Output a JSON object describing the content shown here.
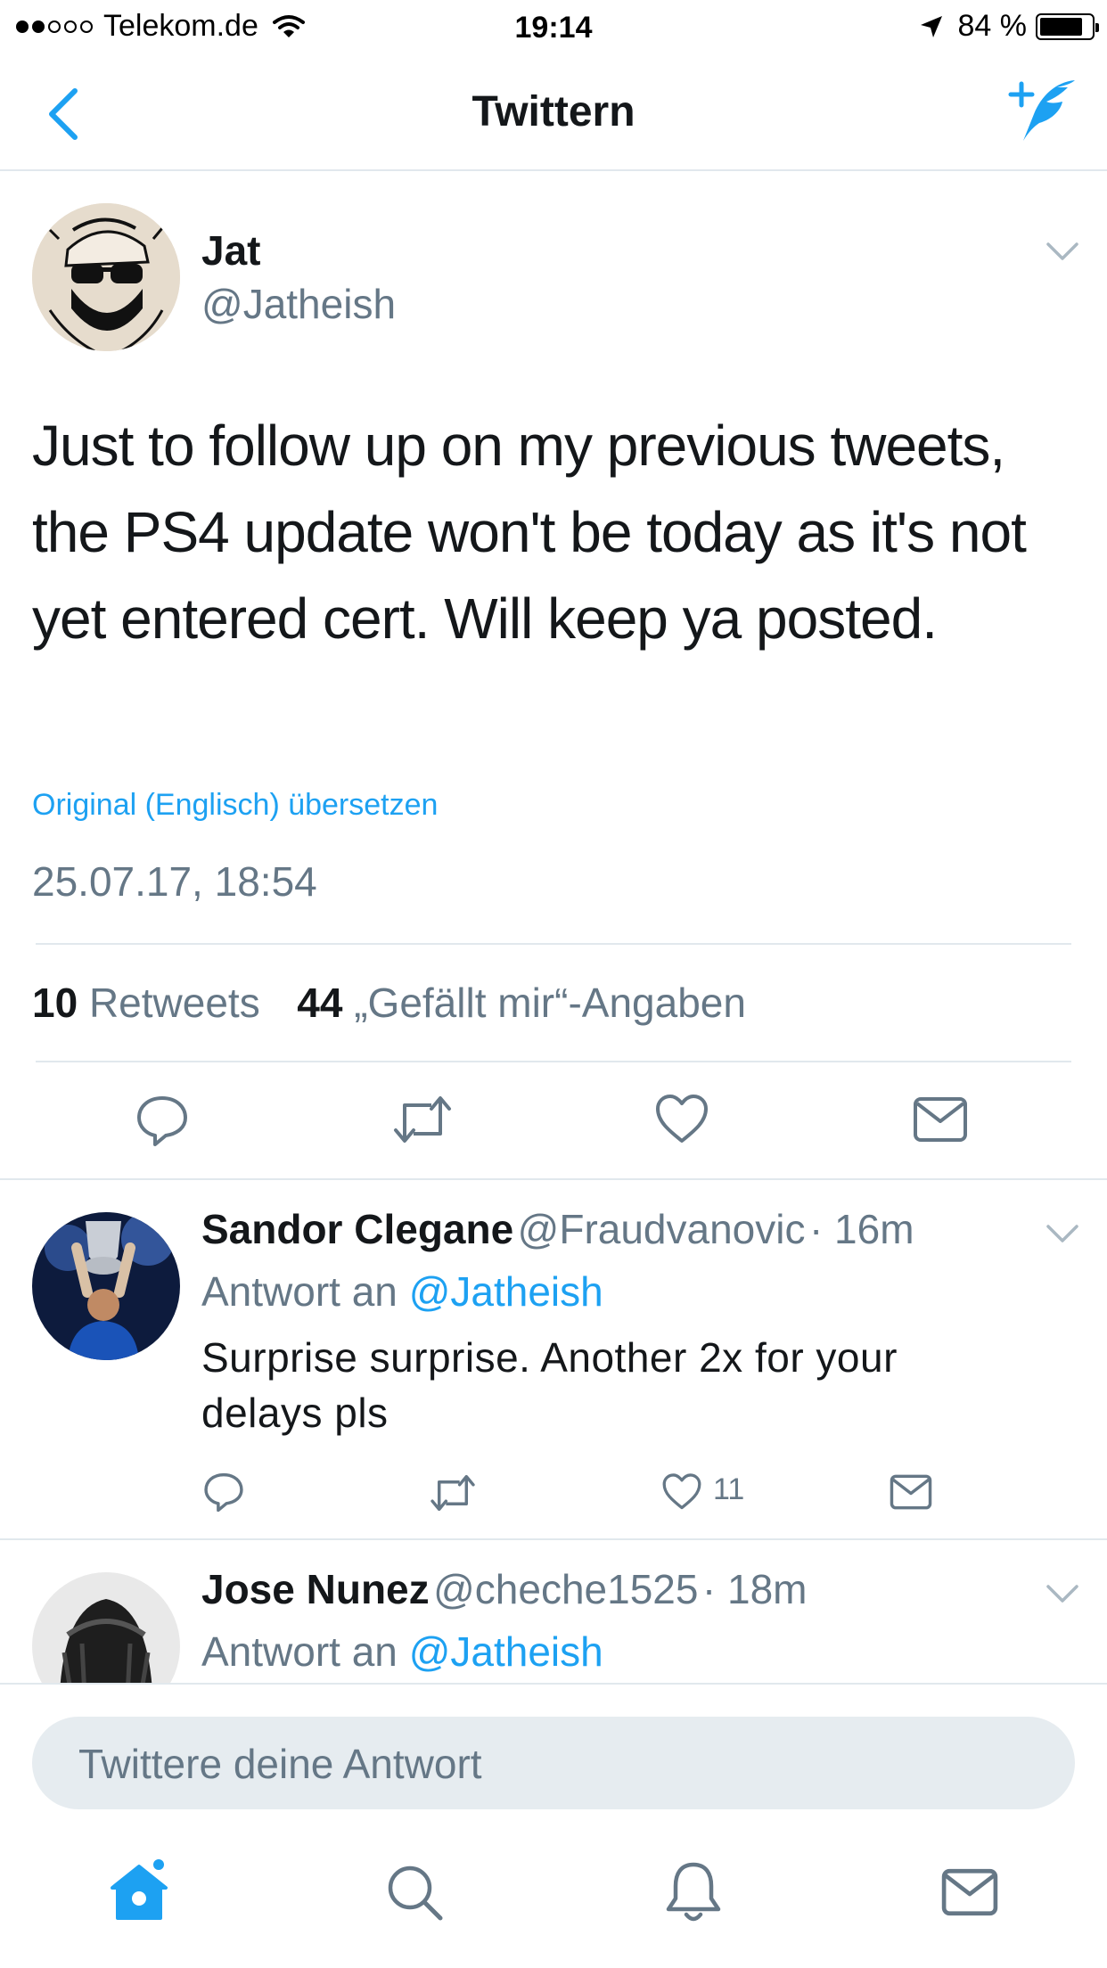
{
  "status_bar": {
    "carrier": "Telekom.de",
    "time": "19:14",
    "battery": "84 %"
  },
  "nav": {
    "title": "Twittern",
    "back_icon": "chevron-left-icon",
    "compose_icon": "compose-tweet-icon"
  },
  "tweet": {
    "name": "Jat",
    "handle": "@Jatheish",
    "text": "Just to follow up on my previous tweets, the PS4 update won't be today as it's not yet entered cert. Will keep ya posted.",
    "translate_link": "Original (Englisch) übersetzen",
    "timestamp": "25.07.17, 18:54",
    "retweet_count": "10",
    "retweet_label": "Retweets",
    "like_count": "44",
    "like_label": "„Gefällt mir“-Angaben"
  },
  "replies": [
    {
      "name": "Sandor Clegane",
      "handle": "@Fraudvanovic",
      "time": "· 16m",
      "reply_prefix": "Antwort an",
      "reply_to": "@Jatheish",
      "text": "Surprise surprise. Another 2x for your delays pls",
      "like_count": "11"
    },
    {
      "name": "Jose Nunez",
      "handle": "@cheche1525",
      "time": "· 18m",
      "reply_prefix": "Antwort an",
      "reply_to": "@Jatheish"
    }
  ],
  "composer": {
    "placeholder": "Twittere deine Antwort"
  },
  "colors": {
    "accent": "#1da1f2",
    "secondary_text": "#657786",
    "divider": "#e1e8ed"
  }
}
